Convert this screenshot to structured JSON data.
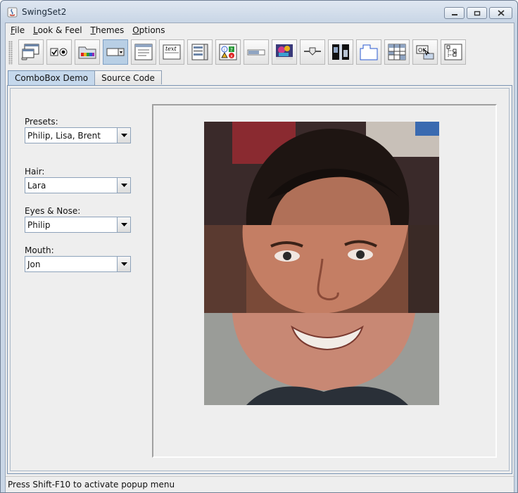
{
  "window": {
    "title": "SwingSet2"
  },
  "menubar": {
    "items": [
      {
        "label": "File",
        "mnemonic": "F",
        "rest": "ile"
      },
      {
        "label": "Look & Feel",
        "mnemonic": "L",
        "rest": "ook & Feel"
      },
      {
        "label": "Themes",
        "mnemonic": "T",
        "rest": "hemes"
      },
      {
        "label": "Options",
        "mnemonic": "O",
        "rest": "ptions"
      }
    ]
  },
  "toolbar": {
    "buttons": [
      {
        "name": "internal-frame-demo-icon",
        "selected": false
      },
      {
        "name": "button-demo-icon",
        "selected": false
      },
      {
        "name": "color-chooser-demo-icon",
        "selected": false
      },
      {
        "name": "combobox-demo-icon",
        "selected": true
      },
      {
        "name": "file-chooser-demo-icon",
        "selected": false
      },
      {
        "name": "html-demo-icon",
        "selected": false
      },
      {
        "name": "list-demo-icon",
        "selected": false
      },
      {
        "name": "option-pane-demo-icon",
        "selected": false
      },
      {
        "name": "progress-bar-demo-icon",
        "selected": false
      },
      {
        "name": "scroll-pane-demo-icon",
        "selected": false
      },
      {
        "name": "slider-demo-icon",
        "selected": false
      },
      {
        "name": "split-pane-demo-icon",
        "selected": false
      },
      {
        "name": "tabbed-pane-demo-icon",
        "selected": false
      },
      {
        "name": "table-demo-icon",
        "selected": false
      },
      {
        "name": "tooltip-demo-icon",
        "selected": false
      },
      {
        "name": "tree-demo-icon",
        "selected": false
      }
    ]
  },
  "tabs": [
    {
      "label": "ComboBox Demo",
      "active": true
    },
    {
      "label": "Source Code",
      "active": false
    }
  ],
  "combobox_demo": {
    "presets": {
      "label": "Presets:",
      "value": "Philip, Lisa, Brent"
    },
    "hair": {
      "label": "Hair:",
      "value": "Lara"
    },
    "eyes_nose": {
      "label": "Eyes & Nose:",
      "value": "Philip"
    },
    "mouth": {
      "label": "Mouth:",
      "value": "Jon"
    }
  },
  "status": {
    "text": "Press Shift-F10 to activate popup menu"
  }
}
